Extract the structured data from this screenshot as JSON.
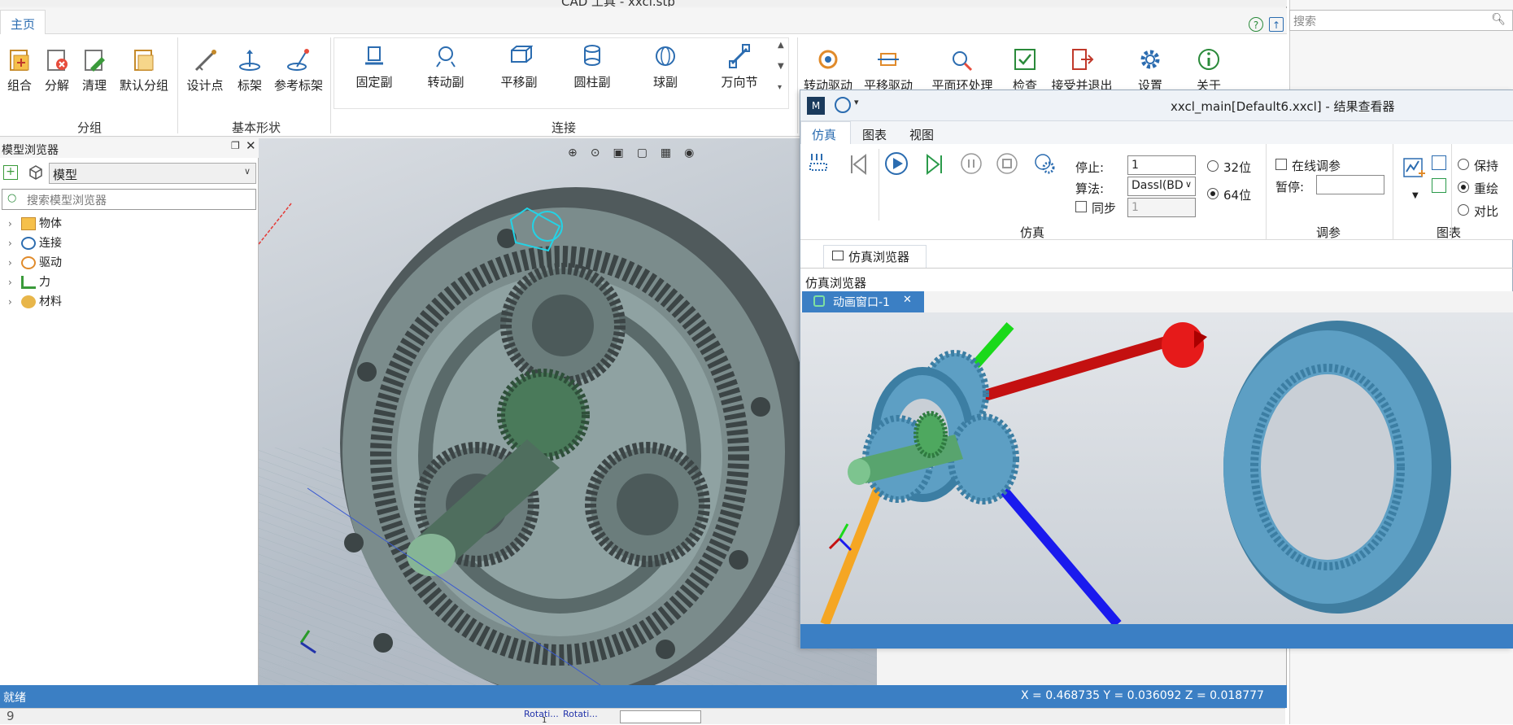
{
  "cad_window": {
    "title": "CAD 工具 - xxcl.stp",
    "active_tab": "主页",
    "groups": [
      {
        "label": "分组",
        "buttons": [
          "组合",
          "分解",
          "清理",
          "默认分组"
        ]
      },
      {
        "label": "基本形状",
        "buttons": [
          "设计点",
          "标架",
          "参考标架"
        ]
      },
      {
        "label": "连接",
        "buttons": [
          "固定副",
          "转动副",
          "平移副",
          "圆柱副",
          "球副",
          "万向节"
        ]
      }
    ],
    "more_buttons": [
      "转动驱动",
      "平移驱动",
      "平面环处理",
      "检查",
      "接受并退出",
      "设置",
      "关于"
    ]
  },
  "model_browser": {
    "title": "模型浏览器",
    "filter_value": "模型",
    "search_placeholder": "搜索模型浏览器",
    "tree": [
      "物体",
      "连接",
      "驱动",
      "力",
      "材料"
    ]
  },
  "status": {
    "text": "就绪",
    "coords": "X = 0.468735  Y = 0.036092  Z = 0.018777"
  },
  "result_viewer": {
    "title": "xxcl_main[Default6.xxcl] - 结果查看器",
    "tabs": [
      "仿真",
      "图表",
      "视图"
    ],
    "stop_label": "停止:",
    "stop_value": "1",
    "algo_label": "算法:",
    "algo_value": "Dassl(BD",
    "sync_label": "同步",
    "sync_value": "1",
    "bit32": "32位",
    "bit64": "64位",
    "online_label": "在线调参",
    "pause_label": "暂停:",
    "group_sim": "仿真",
    "group_tune": "调参",
    "group_chart": "图表",
    "radio_keep": "保持",
    "radio_redraw": "重绘",
    "radio_compare": "对比",
    "sim_browser_tab": "仿真浏览器",
    "sim_browser_title": "仿真浏览器",
    "anim_tab": "动画窗口-1"
  },
  "background": {
    "search_placeholder": "搜索",
    "row_label": "9",
    "rotati_1": "Rotati...",
    "rotati_2": "Rotati...",
    "row_one": "1"
  },
  "colors": {
    "accent": "#3b7fc4",
    "gear_cad": "#6f8a86",
    "gear_anim": "#5d9fc4"
  }
}
